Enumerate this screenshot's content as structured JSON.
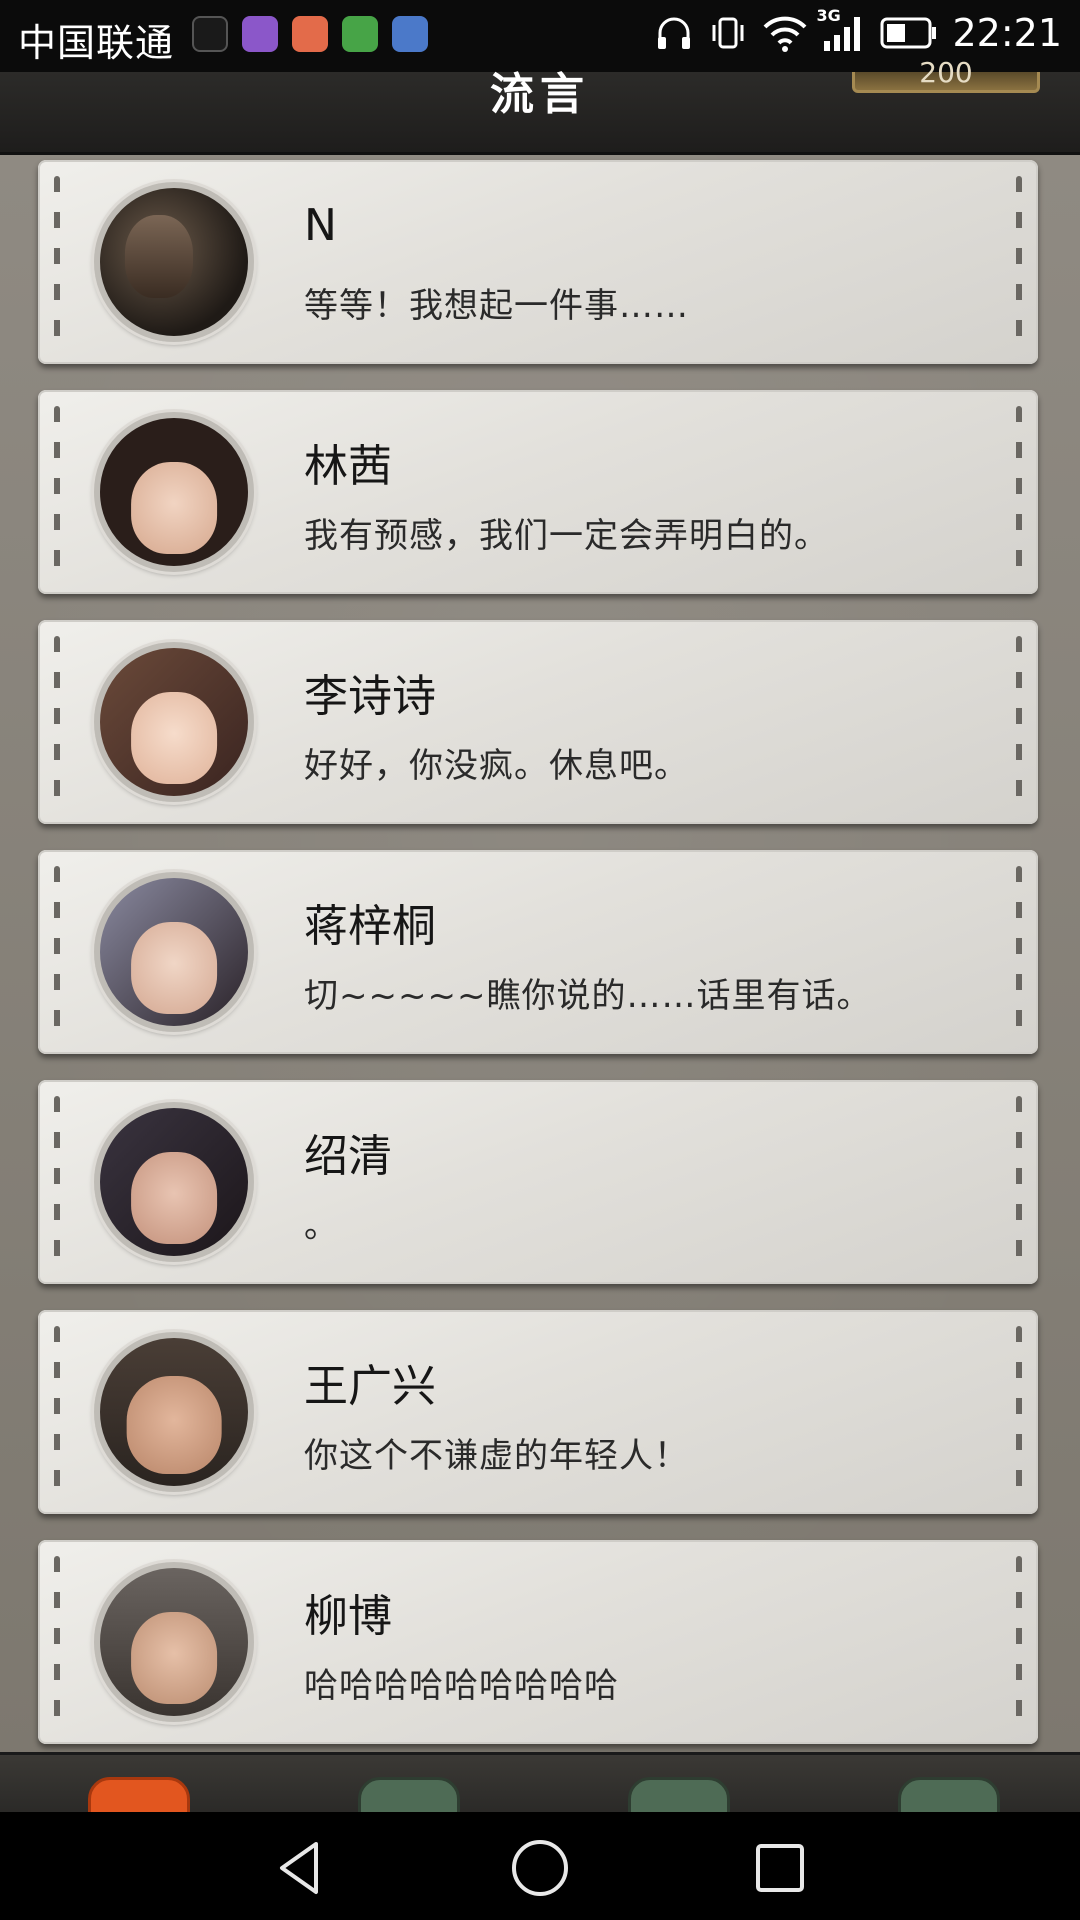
{
  "status_bar": {
    "carrier": "中国联通",
    "network": "3G",
    "time": "22:21"
  },
  "header": {
    "title": "流言",
    "coins": "200"
  },
  "chats": [
    {
      "name": "N",
      "message": "等等！我想起一件事……"
    },
    {
      "name": "林茜",
      "message": "我有预感，我们一定会弄明白的。"
    },
    {
      "name": "李诗诗",
      "message": "好好，你没疯。休息吧。"
    },
    {
      "name": "蒋梓桐",
      "message": "切~~~~~瞧你说的……话里有话。"
    },
    {
      "name": "绍清",
      "message": "。"
    },
    {
      "name": "王广兴",
      "message": "你这个不谦虚的年轻人！"
    },
    {
      "name": "柳博",
      "message": "哈哈哈哈哈哈哈哈哈"
    }
  ],
  "colors": {
    "accent_tab": "#e2561f",
    "tab": "#4e6b55",
    "card": "#e6e4df"
  }
}
